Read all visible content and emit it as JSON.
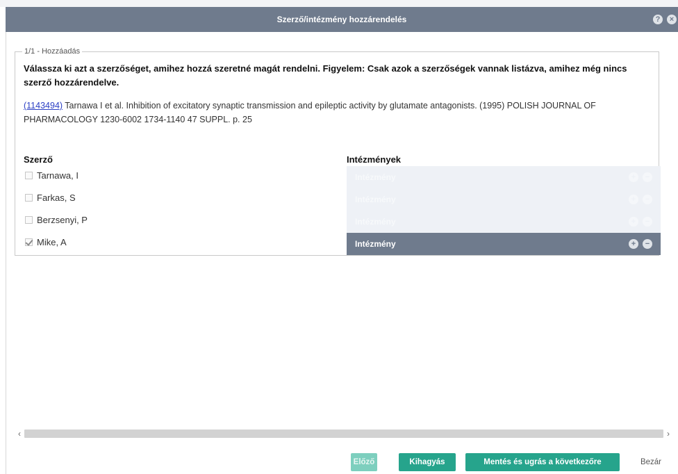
{
  "dialog": {
    "title": "Szerző/intézmény hozzárendelés",
    "help_icon": "question-circle-icon",
    "close_icon": "close-circle-icon"
  },
  "step": {
    "legend": "1/1 - Hozzáadás",
    "instruction": "Válassza ki azt a szerzőséget, amihez hozzá szeretné magát rendelni. Figyelem: Csak azok a szerzőségek vannak listázva, amihez még nincs szerző hozzárendelve.",
    "publication": {
      "id_link": "(1143494)",
      "text": " Tarnawa I et al. Inhibition of excitatory synaptic transmission and epileptic activity by glutamate antagonists. (1995) POLISH JOURNAL OF PHARMACOLOGY 1230-6002 1734-1140 47 SUPPL. p. 25"
    }
  },
  "authors": {
    "header": "Szerző",
    "items": [
      {
        "name": "Tarnawa, I",
        "checked": false
      },
      {
        "name": "Farkas, S",
        "checked": false
      },
      {
        "name": "Berzsenyi, P",
        "checked": false
      },
      {
        "name": "Mike, A",
        "checked": true
      }
    ]
  },
  "institutions": {
    "header": "Intézmények",
    "rows": [
      {
        "label": "Intézmény",
        "state": "faded"
      },
      {
        "label": "Intézmény",
        "state": "faded"
      },
      {
        "label": "Intézmény",
        "state": "faded"
      },
      {
        "label": "Intézmény",
        "state": "active"
      }
    ]
  },
  "scrollbar": {
    "left_arrow": "‹",
    "right_arrow": "›"
  },
  "buttons": {
    "prev": "Előző",
    "skip": "Kihagyás",
    "save_next": "Mentés és ugrás a következőre",
    "close": "Bezár"
  },
  "colors": {
    "titlebar": "#6f7b8d",
    "primary_button": "#26a48c",
    "link": "#2b3fc4"
  }
}
